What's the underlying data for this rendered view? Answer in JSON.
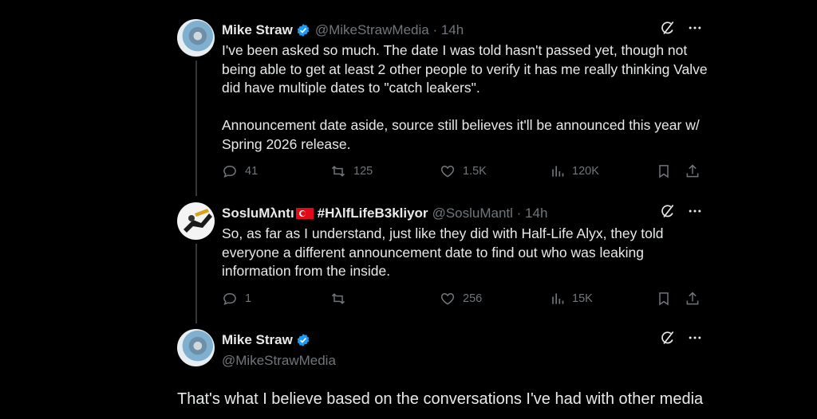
{
  "colors": {
    "background": "#000000",
    "text": "#e7e9ea",
    "muted": "#71767b",
    "verified": "#1d9bf0",
    "thread_line": "#333639"
  },
  "posts": [
    {
      "author": "Mike Straw",
      "handle": "@MikeStrawMedia",
      "time": "14h",
      "verified": true,
      "text": "I've been asked so much. The date I was told hasn't passed yet, though not being able to get at least 2 other people to verify it has me really thinking Valve did have multiple dates to \"catch leakers\".\n\nAnnouncement date aside, source still believes it'll be announced this year w/ Spring 2026 release.",
      "stats": {
        "replies": "41",
        "reposts": "125",
        "likes": "1.5K",
        "views": "120K"
      }
    },
    {
      "author": "SosluMλntı",
      "flag_icon": "turkey-flag-icon",
      "hashtag": "#HλlfLifeB3kliyor",
      "handle": "@SosluMantl",
      "time": "14h",
      "text": "So, as far as I understand, just like they did with Half-Life Alyx, they told everyone a different announcement date to find out who was leaking information from the inside.",
      "stats": {
        "replies": "1",
        "reposts": "",
        "likes": "256",
        "views": "15K"
      }
    }
  ],
  "main_post": {
    "author": "Mike Straw",
    "handle": "@MikeStrawMedia",
    "verified": true,
    "text": "That's what I believe based on the conversations I've had with other media"
  },
  "icons": [
    "grok-icon",
    "more-icon",
    "reply-icon",
    "repost-icon",
    "like-icon",
    "views-icon",
    "bookmark-icon",
    "share-icon",
    "verified-badge-icon"
  ]
}
